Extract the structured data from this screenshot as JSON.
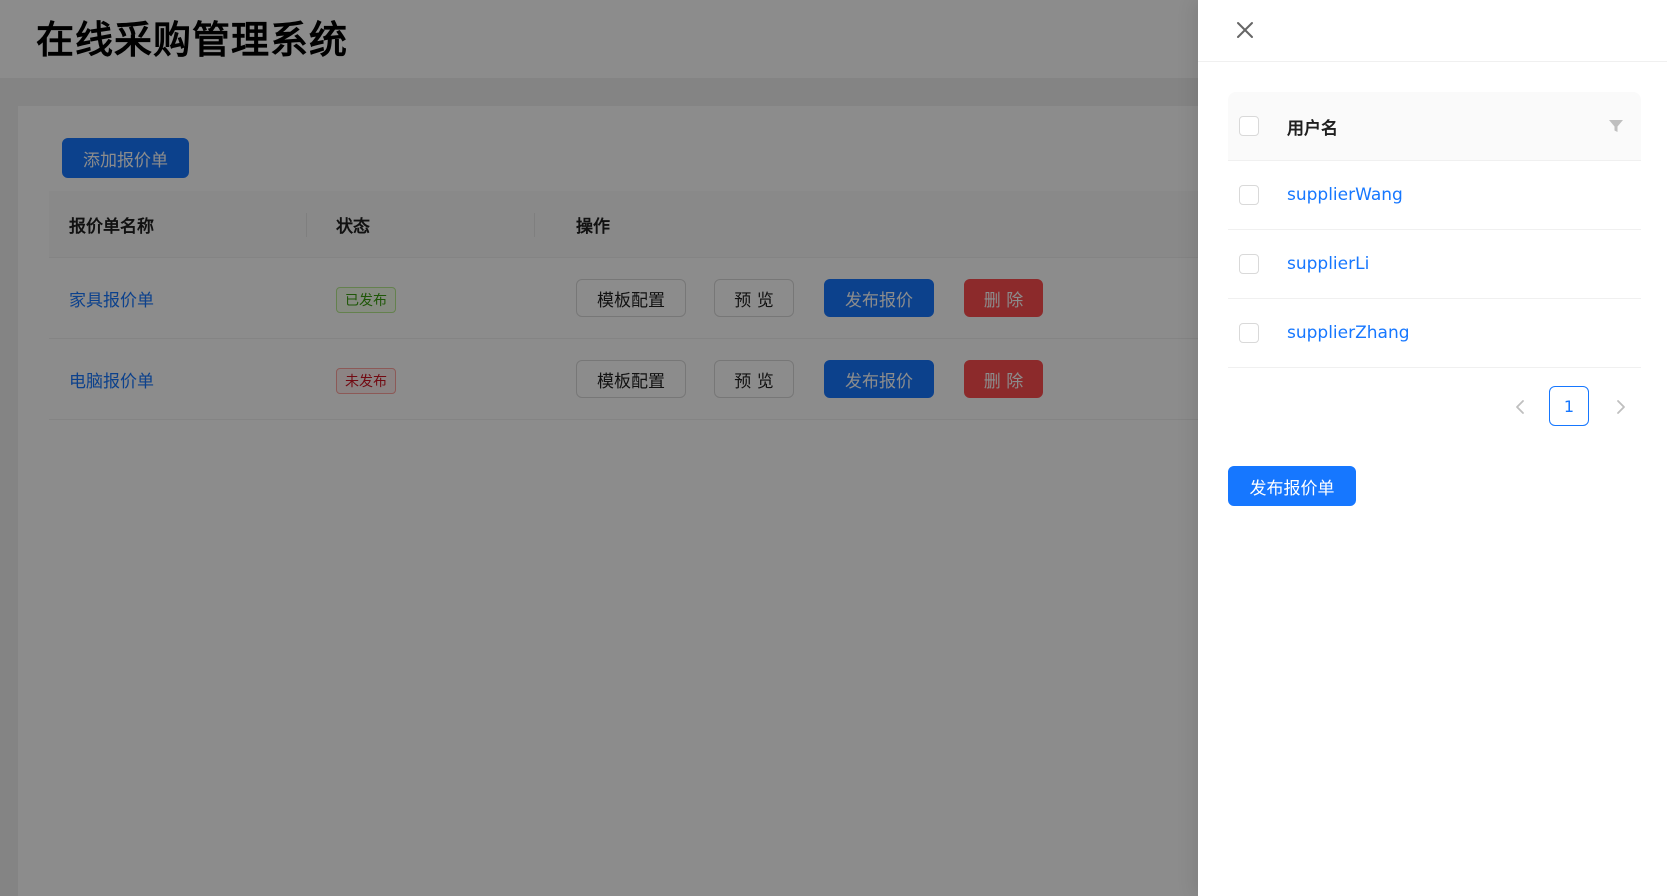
{
  "app": {
    "title": "在线采购管理系统"
  },
  "toolbar": {
    "add_label": "添加报价单"
  },
  "table": {
    "columns": [
      "报价单名称",
      "状态",
      "操作"
    ],
    "rows": [
      {
        "name": "家具报价单",
        "status": "已发布",
        "status_type": "success"
      },
      {
        "name": "电脑报价单",
        "status": "未发布",
        "status_type": "error"
      }
    ],
    "actions": {
      "template": "模板配置",
      "preview": "预 览",
      "publish": "发布报价",
      "delete": "删 除"
    }
  },
  "drawer": {
    "close_icon": "close-icon",
    "column": "用户名",
    "filter_icon": "filter-icon",
    "users": [
      "supplierWang",
      "supplierLi",
      "supplierZhang"
    ],
    "pagination": {
      "current": "1"
    },
    "submit_label": "发布报价单"
  },
  "colors": {
    "primary": "#1677ff",
    "danger": "#ff4d4f",
    "success": "#389e0d",
    "mask": "rgba(0,0,0,0.45)"
  }
}
